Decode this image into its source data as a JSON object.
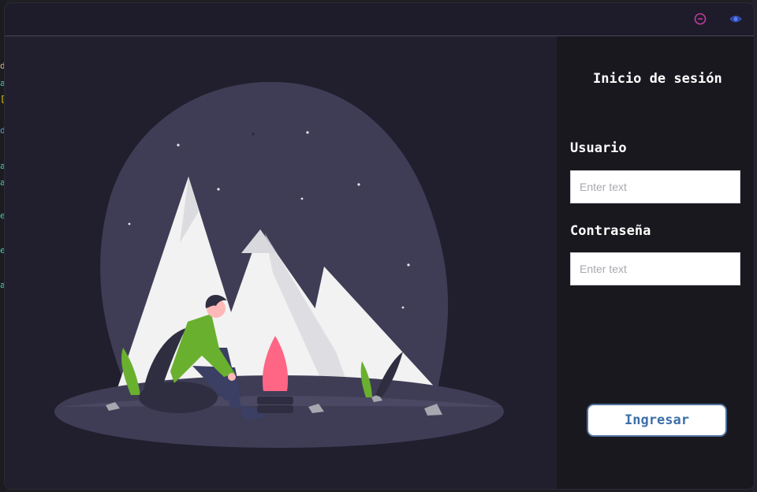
{
  "login": {
    "title": "Inicio de sesión",
    "username_label": "Usuario",
    "username_placeholder": "Enter text",
    "username_value": "",
    "password_label": "Contraseña",
    "password_placeholder": "Enter text",
    "password_value": "",
    "submit_label": "Ingresar"
  },
  "titlebar": {
    "icons": [
      "minimize-icon",
      "eye-icon"
    ]
  },
  "colors": {
    "window_bg": "#201e2c",
    "panel_bg": "#19181f",
    "moon_bg": "#3f3d56",
    "mountain": "#f2f2f2",
    "jacket": "#6ab02f",
    "flame": "#ff6584",
    "button_text": "#3d6fa8"
  }
}
